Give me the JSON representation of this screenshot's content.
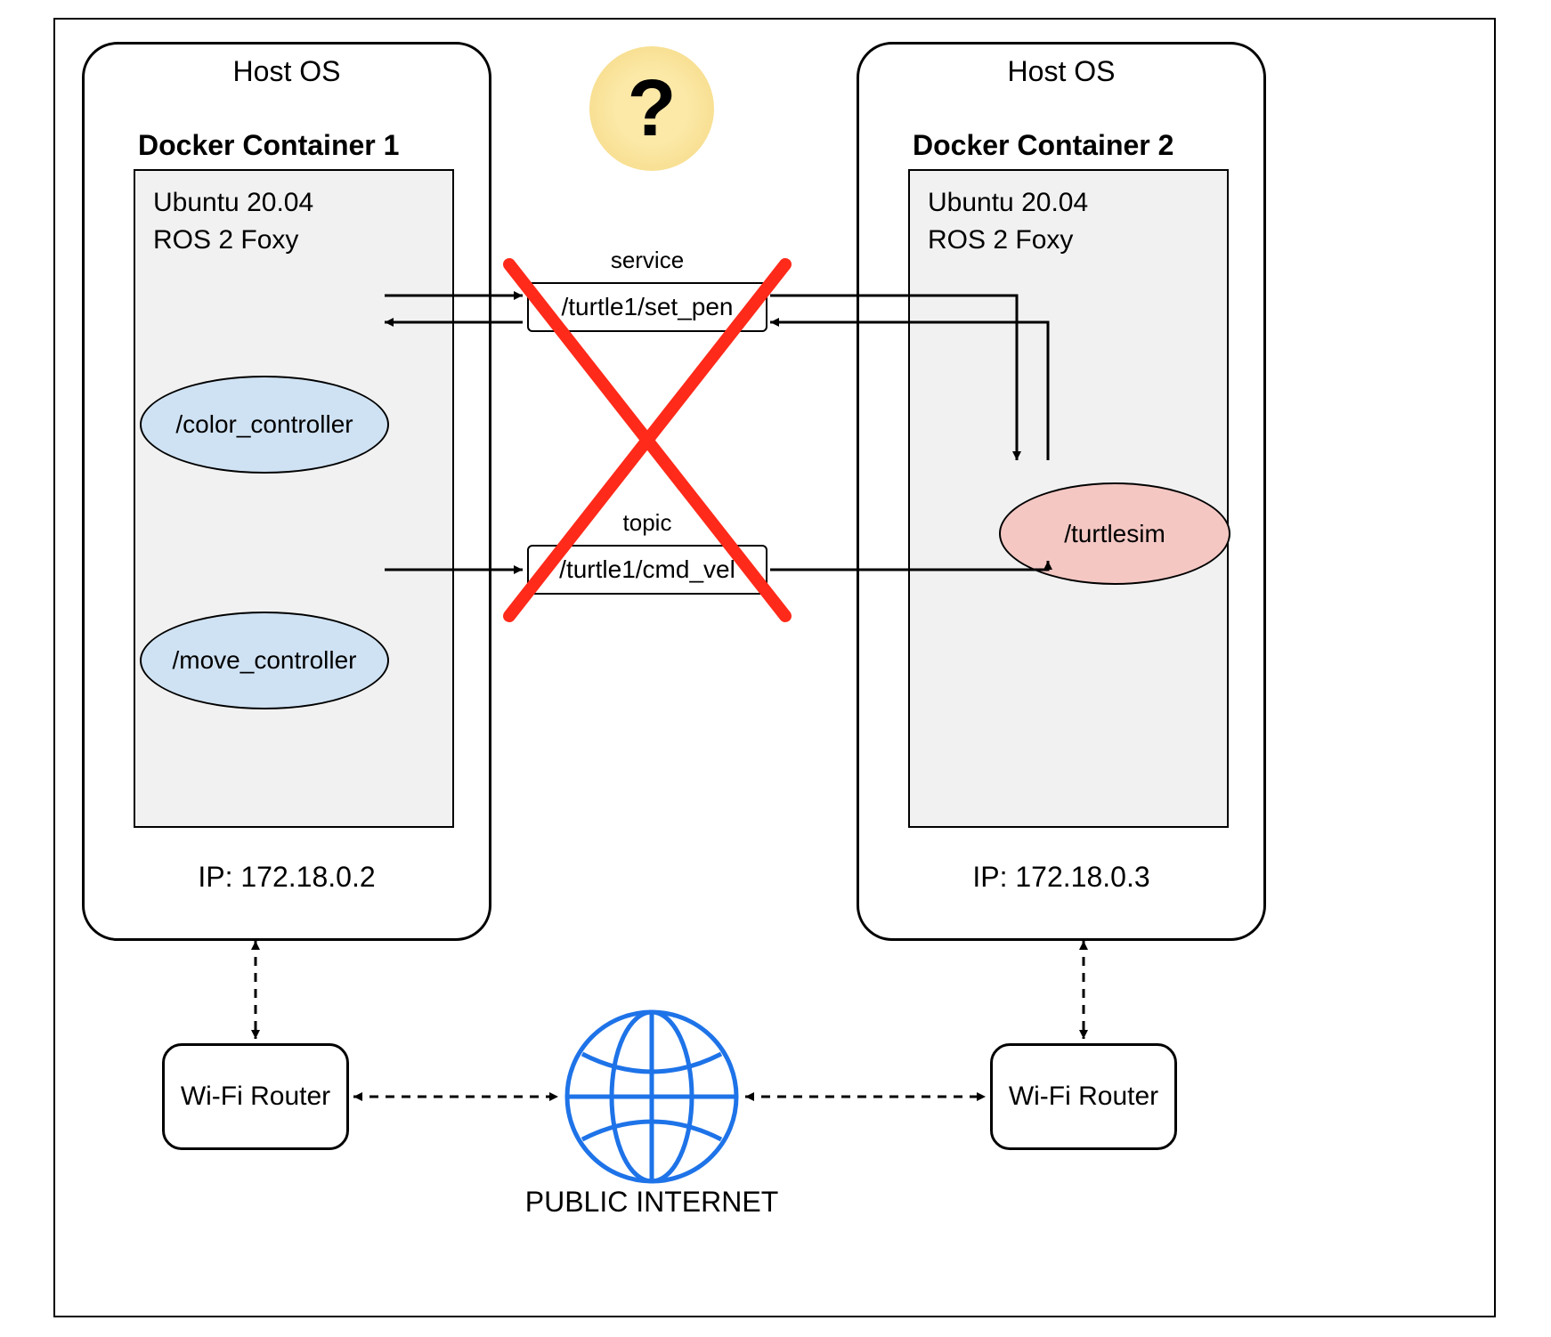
{
  "host1": {
    "title": "Host OS",
    "container_label": "Docker Container 1",
    "os_line1": "Ubuntu 20.04",
    "os_line2": "ROS 2 Foxy",
    "node_color": "/color_controller",
    "node_move": "/move_controller",
    "ip": "IP: 172.18.0.2"
  },
  "host2": {
    "title": "Host OS",
    "container_label": "Docker Container 2",
    "os_line1": "Ubuntu 20.04",
    "os_line2": "ROS 2 Foxy",
    "node_turtlesim": "/turtlesim",
    "ip": "IP: 172.18.0.3"
  },
  "middle": {
    "service_label": "service",
    "service_box": "/turtle1/set_pen",
    "topic_label": "topic",
    "topic_box": "/turtle1/cmd_vel",
    "question": "?"
  },
  "bottom": {
    "wifi1": "Wi-Fi Router",
    "wifi2": "Wi-Fi Router",
    "internet": "PUBLIC INTERNET"
  },
  "colors": {
    "blue_node": "#cfe2f3",
    "red_node": "#f4c7c3",
    "question_bg": "#fce9a8",
    "cross": "#ff2a1a",
    "globe": "#1e73e8"
  }
}
